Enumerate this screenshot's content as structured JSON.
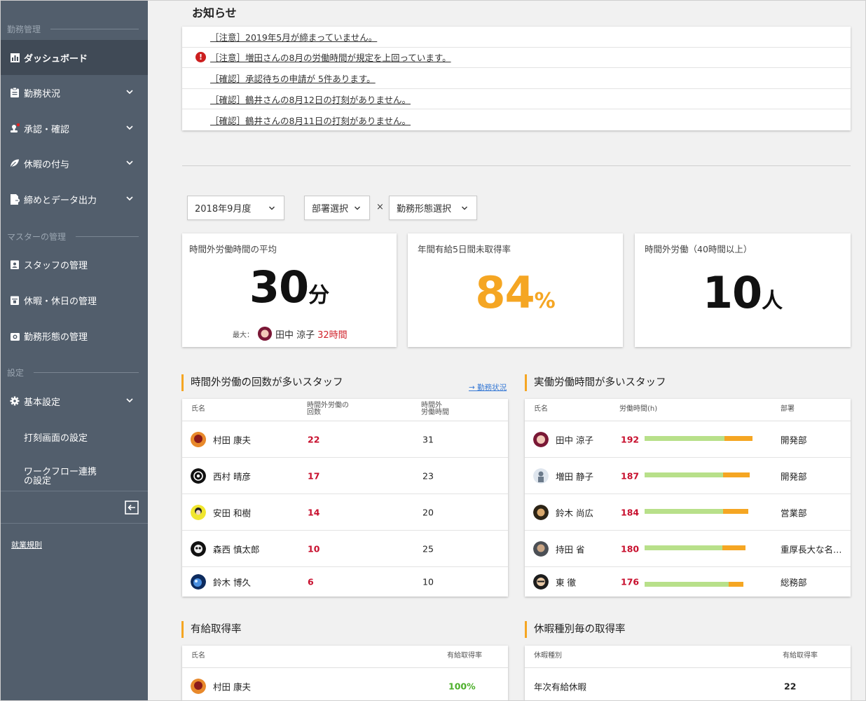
{
  "sidebar": {
    "section_attendance": "勤務管理",
    "section_master": "マスターの管理",
    "section_settings": "設定",
    "items": [
      {
        "label": "ダッシュボード"
      },
      {
        "label": "勤務状況"
      },
      {
        "label": "承認・確認"
      },
      {
        "label": "休暇の付与"
      },
      {
        "label": "締めとデータ出力"
      },
      {
        "label": "スタッフの管理"
      },
      {
        "label": "休暇・休日の管理"
      },
      {
        "label": "勤務形態の管理"
      },
      {
        "label": "基本設定"
      },
      {
        "label": "打刻画面の設定"
      },
      {
        "label": "ワークフロー連携の設定"
      }
    ],
    "rules_link": "就業規則"
  },
  "notices": {
    "title": "お知らせ",
    "items": [
      {
        "text": "［注意］2019年5月が締まっていません。",
        "alert": false
      },
      {
        "text": "［注意］増田さんの8月の労働時間が規定を上回っています。",
        "alert": true
      },
      {
        "text": "［確認］承認待ちの申請が 5件あります。",
        "alert": false
      },
      {
        "text": "［確認］鶴井さんの8月12日の打刻がありません。",
        "alert": false
      },
      {
        "text": "［確認］鶴井さんの8月11日の打刻がありません。",
        "alert": false
      }
    ]
  },
  "filters": {
    "period": "2018年9月度",
    "department": "部署選択",
    "times": "×",
    "work_style": "勤務形態選択"
  },
  "kpis": {
    "overtime_avg": {
      "label": "時間外労働時間の平均",
      "value": "30",
      "unit": "分",
      "max_label": "最大：",
      "max_name": "田中 涼子",
      "max_value": "32時間"
    },
    "paid_leave": {
      "label": "年間有給5日間未取得率",
      "value": "84",
      "unit": "%"
    },
    "overtime_40": {
      "label": "時間外労働（40時間以上）",
      "value": "10",
      "unit": "人"
    }
  },
  "overtime_count": {
    "title": "時間外労働の回数が多いスタッフ",
    "link": "→ 勤務状況",
    "headers": {
      "name": "氏名",
      "count_1": "時間外労働の",
      "count_2": "回数",
      "hours_1": "時間外",
      "hours_2": "労働時間"
    },
    "rows": [
      {
        "name": "村田 康夫",
        "count": "22",
        "hours": "31"
      },
      {
        "name": "西村 晴彦",
        "count": "17",
        "hours": "23"
      },
      {
        "name": "安田 和樹",
        "count": "14",
        "hours": "20"
      },
      {
        "name": "森西 慎太郎",
        "count": "10",
        "hours": "25"
      },
      {
        "name": "鈴木 博久",
        "count": "6",
        "hours": "10"
      }
    ]
  },
  "actual_hours": {
    "title": "実働労働時間が多いスタッフ",
    "headers": {
      "name": "氏名",
      "hours": "労働時間(h)",
      "dept": "部署"
    },
    "rows": [
      {
        "name": "田中 涼子",
        "hours": "192",
        "regular": 0.74,
        "overtime": 0.26,
        "dept": "開発部"
      },
      {
        "name": "増田 静子",
        "hours": "187",
        "regular": 0.75,
        "overtime": 0.25,
        "dept": "開発部"
      },
      {
        "name": "鈴木 尚広",
        "hours": "184",
        "regular": 0.76,
        "overtime": 0.24,
        "dept": "営業部"
      },
      {
        "name": "持田 省",
        "hours": "180",
        "regular": 0.77,
        "overtime": 0.23,
        "dept": "重厚長大な名…"
      },
      {
        "name": "東 徹",
        "hours": "176",
        "regular": 0.85,
        "overtime": 0.15,
        "dept": "総務部"
      }
    ]
  },
  "paid_leave_rate": {
    "title": "有給取得率",
    "headers": {
      "name": "氏名",
      "rate": "有給取得率"
    },
    "rows": [
      {
        "name": "村田 康夫",
        "rate": "100%"
      }
    ]
  },
  "leave_type_rate": {
    "title": "休暇種別毎の取得率",
    "headers": {
      "type": "休暇種別",
      "rate": "有給取得率"
    },
    "rows": [
      {
        "type": "年次有給休暇",
        "rate": "22"
      }
    ]
  },
  "colors": {
    "sidebar": "#525e6c",
    "accent": "#f5a623",
    "red": "#c8102e",
    "green": "#4caf2a",
    "bar_regular": "#b8e08a",
    "bar_overtime": "#f5a623"
  }
}
